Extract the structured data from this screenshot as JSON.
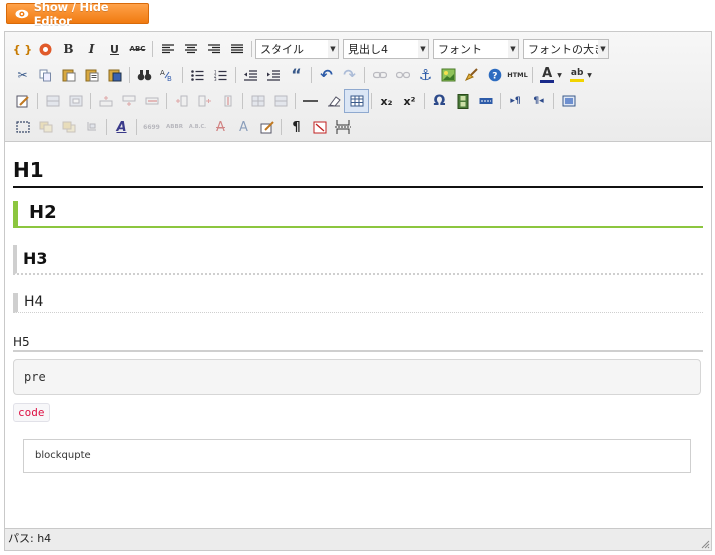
{
  "toggle_button": {
    "label": "Show / Hide Editor"
  },
  "toolbar": {
    "row1": {
      "bold": "B",
      "italic": "I",
      "underline": "U",
      "strikethrough": "ABC",
      "style_select": "スタイル",
      "format_select": "見出し4",
      "font_select": "フォント",
      "fontsize_select": "フォントの大き"
    },
    "row2": {
      "html_label": "HTML",
      "font_color_label": "A",
      "highlight_label": "ab"
    },
    "row3": {
      "subscript": "x₂",
      "superscript": "x²",
      "omega": "Ω"
    },
    "row4": {
      "cite": "6699",
      "abbr": "ABBR",
      "acronym": "A.B.C.",
      "del_label": "A",
      "ins_label": "A",
      "pilcrow": "¶"
    }
  },
  "content": {
    "h1": "H1",
    "h2": "H2",
    "h3": "H3",
    "h4": "H4",
    "h5": "H5",
    "pre": "pre",
    "code": "code",
    "blockquote": "blockqupte"
  },
  "statusbar": {
    "path": "パス: h4"
  },
  "colors": {
    "toggle_orange": "#f08a20",
    "h2_accent": "#8cc63f",
    "code_red": "#dd1144",
    "font_color_bar": "#1a2a8a",
    "highlight_bar": "#f2d400"
  }
}
